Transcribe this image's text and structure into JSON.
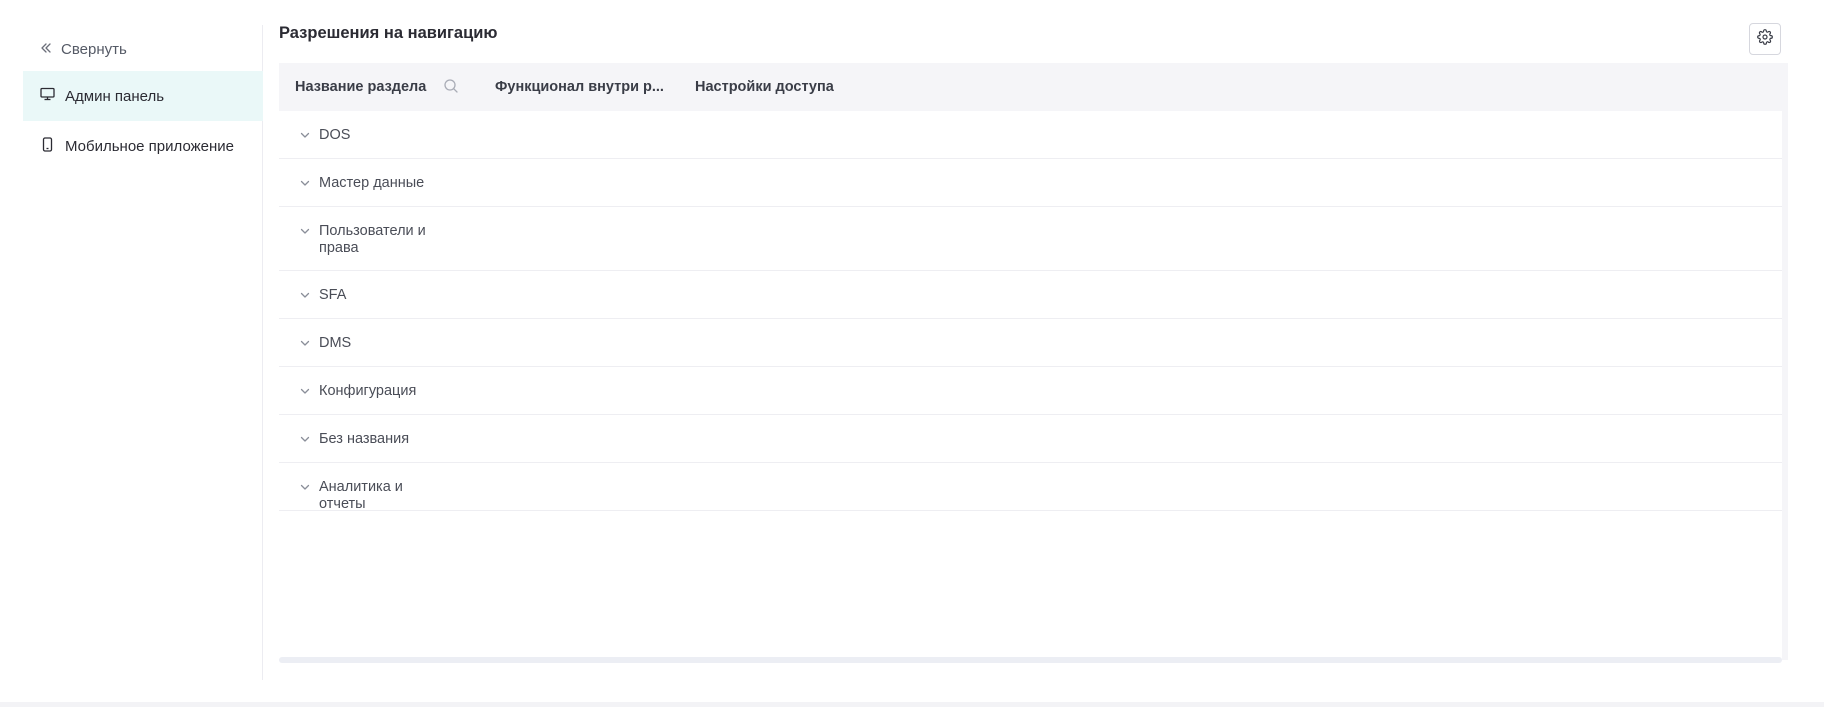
{
  "sidebar": {
    "collapse_label": "Свернуть",
    "items": [
      {
        "label": "Админ панель",
        "icon": "monitor-icon",
        "active": true
      },
      {
        "label": "Мобильное приложение",
        "icon": "smartphone-icon",
        "active": false
      }
    ]
  },
  "main": {
    "title": "Разрешения на навигацию",
    "settings_icon": "gear-icon"
  },
  "table": {
    "columns": {
      "name": "Название раздела",
      "functional": "Функционал внутри р...",
      "access": "Настройки доступа"
    },
    "rows": [
      {
        "label": "DOS"
      },
      {
        "label": "Мастер данные"
      },
      {
        "label": "Пользователи и права"
      },
      {
        "label": "SFA"
      },
      {
        "label": "DMS"
      },
      {
        "label": "Конфигурация"
      },
      {
        "label": "Без названия"
      },
      {
        "label": "Аналитика и отчеты"
      }
    ]
  },
  "colors": {
    "active_bg": "#eaf8f8",
    "header_bg": "#f5f5f8",
    "page_bg": "#ffffff",
    "outer_bg": "#f3f3f6"
  }
}
